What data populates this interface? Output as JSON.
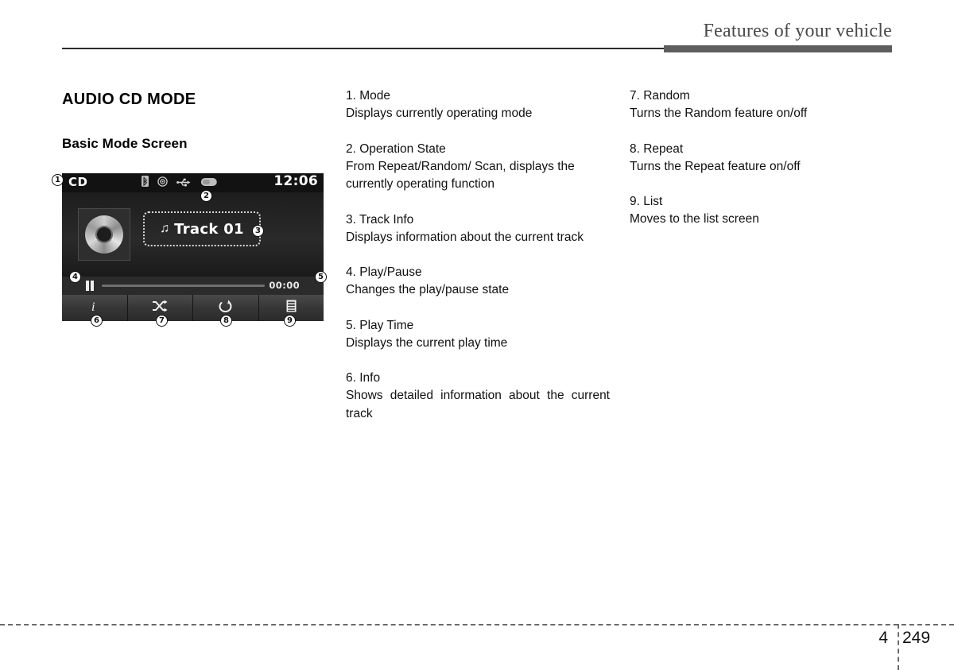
{
  "header": {
    "title": "Features of your vehicle"
  },
  "section": {
    "title": "AUDIO CD MODE",
    "subtitle": "Basic Mode Screen"
  },
  "device": {
    "mode_label": "CD",
    "clock": "12:06",
    "status_icons": [
      "bluetooth-icon",
      "disc-icon",
      "usb-icon",
      "oval-icon"
    ],
    "operation_state_icon": "repeat-state-icon",
    "track_title": "Track 01",
    "track_note_icon": "music-note-icon",
    "play_pause_icon": "pause-icon",
    "play_time": "00:00",
    "buttons": [
      {
        "name": "info-button",
        "icon": "info-icon",
        "marker": "6"
      },
      {
        "name": "random-button",
        "icon": "shuffle-icon",
        "marker": "7"
      },
      {
        "name": "repeat-button",
        "icon": "repeat-icon",
        "marker": "8"
      },
      {
        "name": "list-button",
        "icon": "list-icon",
        "marker": "9"
      }
    ],
    "markers": {
      "mode": "1",
      "operation_state": "2",
      "track_info": "3",
      "play_pause": "4",
      "play_time": "5"
    }
  },
  "legend": {
    "column2": [
      {
        "label": "1. Mode",
        "desc": "Displays currently operating mode",
        "justify": false
      },
      {
        "label": "2. Operation State",
        "desc": "From Repeat/Random/ Scan, displays the currently operating function",
        "justify": false
      },
      {
        "label": "3. Track Info",
        "desc": "Displays information about the current track",
        "justify": true
      },
      {
        "label": "4. Play/Pause",
        "desc": "Changes the play/pause state",
        "justify": false
      },
      {
        "label": "5. Play Time",
        "desc": "Displays the current play time",
        "justify": false
      },
      {
        "label": "6. Info",
        "desc": "Shows detailed information about the current track",
        "justify": true
      }
    ],
    "column3": [
      {
        "label": "7. Random",
        "desc": "Turns the Random feature on/off",
        "justify": false
      },
      {
        "label": "8. Repeat",
        "desc": "Turns the Repeat feature on/off",
        "justify": false
      },
      {
        "label": "9. List",
        "desc": "Moves to the list screen",
        "justify": false
      }
    ]
  },
  "footer": {
    "chapter": "4",
    "page": "249"
  },
  "colors": {
    "rule_dark": "#2b2b2b",
    "rule_gray": "#5e5e5e",
    "header_text": "#4a4a4a",
    "body_text": "#111111"
  }
}
